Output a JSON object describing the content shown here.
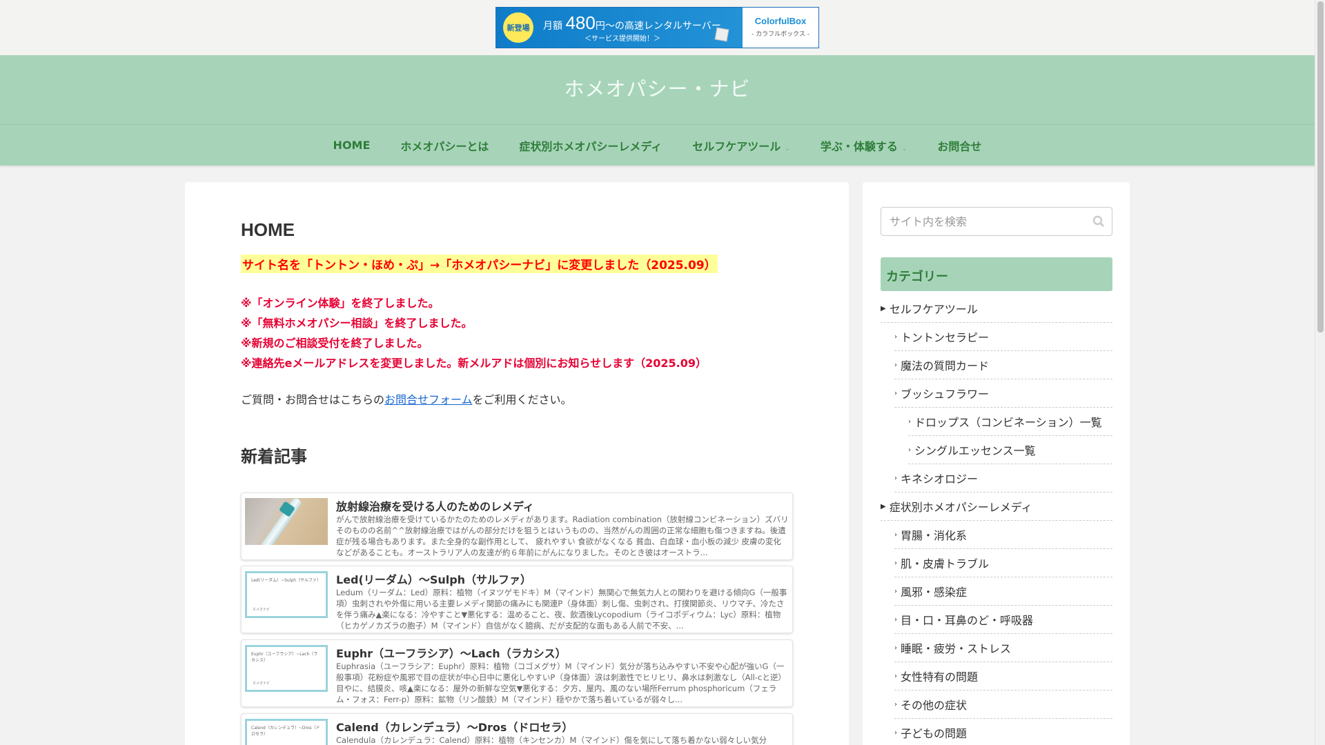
{
  "ad": {
    "badge": "新登場",
    "line1_pre": "月額",
    "price": "480",
    "line1_post": "円～の高速レンタルサーバー",
    "line2": "＜サービス提供開始！＞",
    "brand": "ColorfulBox",
    "brand_sub": "- カラフルボックス -"
  },
  "site_title": "ホメオパシー・ナビ",
  "nav": [
    {
      "label": "HOME"
    },
    {
      "label": "ホメオパシーとは"
    },
    {
      "label": "症状別ホメオパシーレメディ"
    },
    {
      "label": "セルフケアツール",
      "dropdown": true
    },
    {
      "label": "学ぶ・体験する",
      "dropdown": true
    },
    {
      "label": "お問合せ"
    }
  ],
  "main": {
    "title": "HOME",
    "highlight": "サイト名を「トントン・ほめ・ぷ」→「ホメオパシーナビ」に変更しました（2025.09）",
    "notices": [
      "※「オンライン体験」を終了しました。",
      "※「無料ホメオパシー相談」を終了しました。",
      "※新規のご相談受付を終了しました。",
      "※連絡先eメールアドレスを変更しました。新メルアドは個別にお知らせします（2025.09）"
    ],
    "contact_pre": "ご質問・お問合せはこちらの",
    "contact_link": "お問合せフォーム",
    "contact_post": "をご利用ください。",
    "new_heading": "新着記事",
    "articles": [
      {
        "title": "放射線治療を受ける人のためのレメディ",
        "snippet": "がんで放射線治療を受けているかたのためのレメディがあります。Radiation combination（放射線コンビネーション）ズバリそのものの名前^^放射線治療ではがんの部分だけを狙うとはいうものの、当然がんの周囲の正常な細胞も傷つきますね。後遺症が残る場合もあります。また全身的な副作用として、 疲れやすい 食欲がなくなる 貧血、白血球・血小板の減少 皮膚の変化などがあることも。オーストラリア人の友達が約６年前にがんになりました。そのとき彼はオーストラ..."
      },
      {
        "title": "Led(リーダム）～Sulph（サルファ）",
        "thumb_text": "Led(リーダム）~Sulph（サルファ）",
        "thumb_logo": "ホメオナビ",
        "snippet": "Ledum（リーダム：Led）原料：植物（イヌツゲモドキ）M（マインド）無関心で無気力人との関わりを避ける傾向G（一般事項）虫刺されや外傷に用いる主要レメディ関節の痛みにも関連P（身体面）刺し傷、虫刺され、打撲関節炎、リウマチ、冷たさを伴う痛み▲楽になる：冷やすこと▼悪化する：温めること、夜、飲酒後Lycopodium（ライコポディウム：Lyc）原料：植物（ヒカゲノカズラの胞子）M（マインド）自信がなく臆病、だが支配的な面もある人前で不安、..."
      },
      {
        "title": "Euphr（ユーフラシア）～Lach（ラカシス）",
        "thumb_text": "Euphr（ユーフラシア）~Lach（ラカシス）",
        "thumb_logo": "ホメオナビ",
        "snippet": "Euphrasia（ユーフラシア：Euphr）原料：植物（コゴメグサ）M（マインド）気分が落ち込みやすい不安や心配が強いG（一般事項）花粉症や風邪で目の症状が中心日中に悪化しやすいP（身体面）涙は刺激性でヒリヒリ、鼻水は刺激なし（All-cと逆）目やに、結膜炎、咳▲楽になる：屋外の新鮮な空気▼悪化する：夕方、屋内、風のない場所Ferrum phosphoricum（フェラム・フォス：Ferr-p）原料：鉱物（リン酸鉄）M（マインド）穏やかで落ち着いているが弱々し..."
      },
      {
        "title": "Calend（カレンデュラ）～Dros（ドロセラ）",
        "thumb_text": "Calend（カレンデュラ）~Dros（ドロセラ）",
        "snippet": "Calendula（カレンデュラ：Calend）原料：植物（キンセンカ）M（マインド）傷を気にして落ち着かない弱々しい気分"
      }
    ]
  },
  "sidebar": {
    "search_placeholder": "サイト内を検索",
    "category_heading": "カテゴリー",
    "categories": [
      {
        "label": "セルフケアツール",
        "level": 0
      },
      {
        "label": "トントンセラピー",
        "level": 1
      },
      {
        "label": "魔法の質問カード",
        "level": 1
      },
      {
        "label": "ブッシュフラワー",
        "level": 1
      },
      {
        "label": "ドロップス（コンビネーション）一覧",
        "level": 2
      },
      {
        "label": "シングルエッセンス一覧",
        "level": 2
      },
      {
        "label": "キネシオロジー",
        "level": 1
      },
      {
        "label": "症状別ホメオパシーレメディ",
        "level": 0
      },
      {
        "label": "胃腸・消化系",
        "level": 1
      },
      {
        "label": "肌・皮膚トラブル",
        "level": 1
      },
      {
        "label": "風邪・感染症",
        "level": 1
      },
      {
        "label": "目・口・耳鼻のど・呼吸器",
        "level": 1
      },
      {
        "label": "睡眠・疲労・ストレス",
        "level": 1
      },
      {
        "label": "女性特有の問題",
        "level": 1
      },
      {
        "label": "その他の症状",
        "level": 1
      },
      {
        "label": "子どもの問題",
        "level": 1
      }
    ]
  }
}
